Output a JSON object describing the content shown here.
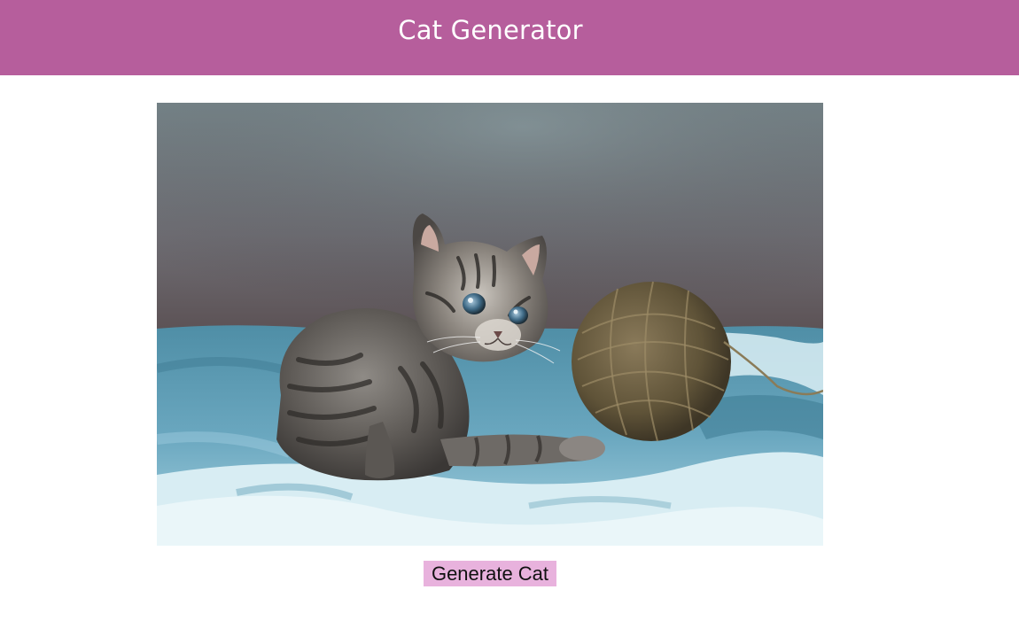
{
  "header": {
    "title": "Cat Generator"
  },
  "photo": {
    "subject": "tabby kitten with ball of yarn on blue blanket"
  },
  "actions": {
    "generate_label": "Generate Cat"
  },
  "colors": {
    "header_bg": "#b65e9c",
    "header_text": "#ffffff",
    "button_bg": "#e8b2dd",
    "button_text": "#111111",
    "page_bg": "#ffffff"
  }
}
